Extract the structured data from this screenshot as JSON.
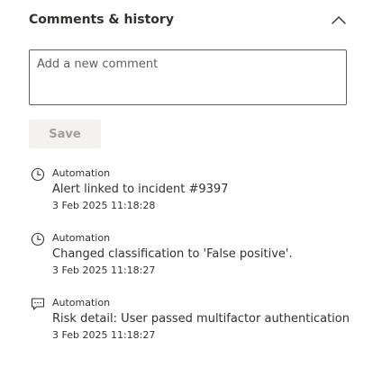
{
  "section": {
    "title": "Comments & history",
    "collapse_icon": "chevron-up-icon"
  },
  "comment": {
    "placeholder": "Add a new comment",
    "value": ""
  },
  "save_button": {
    "label": "Save",
    "disabled": true
  },
  "history": [
    {
      "icon": "clock-icon",
      "source": "Automation",
      "text": "Alert linked to incident #9397",
      "timestamp": "3 Feb 2025 11:18:28"
    },
    {
      "icon": "clock-icon",
      "source": "Automation",
      "text": "Changed classification to 'False positive'.",
      "timestamp": "3 Feb 2025 11:18:27"
    },
    {
      "icon": "comment-icon",
      "source": "Automation",
      "text": "Risk detail: User passed multifactor authentication",
      "timestamp": "3 Feb 2025 11:18:27"
    }
  ]
}
